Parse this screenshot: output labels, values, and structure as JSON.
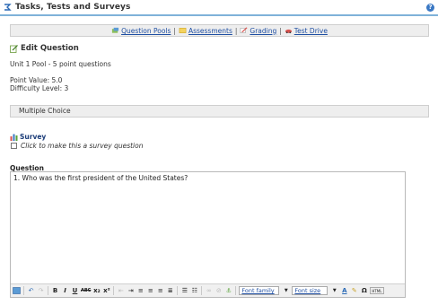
{
  "window": {
    "title": "Tasks, Tests and Surveys"
  },
  "nav": {
    "links": [
      "Question Pools",
      "Assessments",
      "Grading",
      "Test Drive"
    ],
    "separator": "|"
  },
  "edit": {
    "heading": "Edit Question",
    "pool_info": "Unit 1 Pool - 5 point questions",
    "point_value": "Point Value: 5.0",
    "difficulty": "Difficulty Level: 3",
    "question_type": "Multiple Choice"
  },
  "survey": {
    "title": "Survey",
    "checkbox_label": "Click to make this a survey question"
  },
  "question": {
    "label": "Question",
    "text": "1. Who was the first president of the United States?"
  },
  "toolbar": {
    "bold": "B",
    "italic": "I",
    "underline": "U",
    "strike": "ABC",
    "subscript": "x₂",
    "superscript": "x²",
    "font_family": "Font family",
    "font_size": "Font size",
    "omega": "Ω",
    "html": "HTML"
  },
  "colors": {
    "accent": "#7fb2d9",
    "link": "#1f4fa3",
    "panel": "#eeeeee"
  },
  "icons": [
    "app-icon",
    "help-icon",
    "pool-icon",
    "assessment-icon",
    "grading-icon",
    "test-drive-icon",
    "edit-icon",
    "chart-icon"
  ]
}
